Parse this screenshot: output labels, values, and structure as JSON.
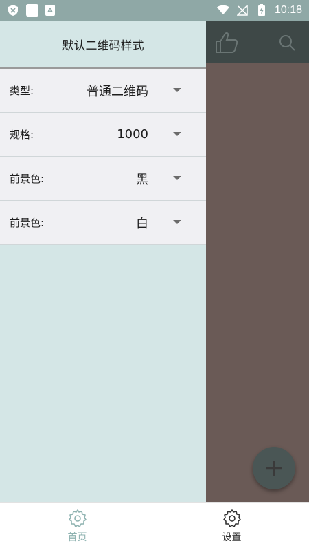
{
  "status_bar": {
    "time": "10:18",
    "notification_letter": "A"
  },
  "drawer": {
    "title": "默认二维码样式",
    "settings": [
      {
        "label": "类型:",
        "value": "普通二维码"
      },
      {
        "label": "规格:",
        "value": "1000"
      },
      {
        "label": "前景色:",
        "value": "黑"
      },
      {
        "label": "前景色:",
        "value": "白"
      }
    ]
  },
  "bottom_nav": {
    "items": [
      {
        "label": "首页",
        "icon": "gear-icon",
        "active": true
      },
      {
        "label": "设置",
        "icon": "gear-icon",
        "active": false
      }
    ]
  },
  "colors": {
    "status_bar": "#8fa8a6",
    "drawer_bg": "#d4e6e6",
    "app_bar": "#3e4847",
    "content_bg": "#6a5a56",
    "nav_active": "#8fb3b1"
  }
}
